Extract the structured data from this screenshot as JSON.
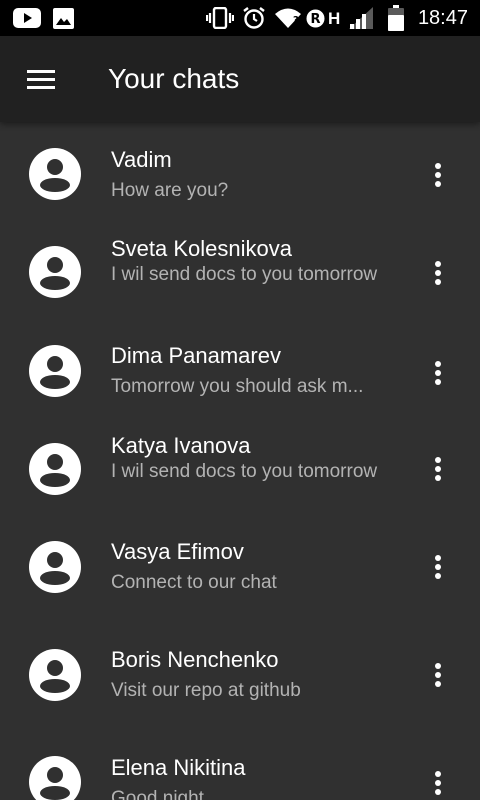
{
  "status_bar": {
    "time": "18:47",
    "network_letter": "H",
    "left_icons": [
      "youtube-icon",
      "image-icon"
    ],
    "right_icons": [
      "vibrate-icon",
      "alarm-icon",
      "wifi-icon",
      "roaming-icon",
      "signal-icon",
      "battery-icon"
    ]
  },
  "app_bar": {
    "title": "Your chats",
    "menu_icon": "hamburger-menu-icon"
  },
  "chats": [
    {
      "name": "Vadim",
      "message": "How are you?"
    },
    {
      "name": "Sveta Kolesnikova",
      "message": "I wil send docs to you tomorrow"
    },
    {
      "name": "Dima Panamarev",
      "message": "Tomorrow you should ask m..."
    },
    {
      "name": "Katya Ivanova",
      "message": "I wil send docs to you tomorrow"
    },
    {
      "name": "Vasya Efimov",
      "message": "Connect to our chat"
    },
    {
      "name": "Boris Nenchenko",
      "message": "Visit our repo at github"
    },
    {
      "name": "Elena Nikitina",
      "message": "Good night"
    }
  ],
  "colors": {
    "status_bar_bg": "#000000",
    "app_bar_bg": "#212121",
    "list_bg": "#303030",
    "primary_text": "#ffffff",
    "secondary_text": "#b3b3b3"
  }
}
